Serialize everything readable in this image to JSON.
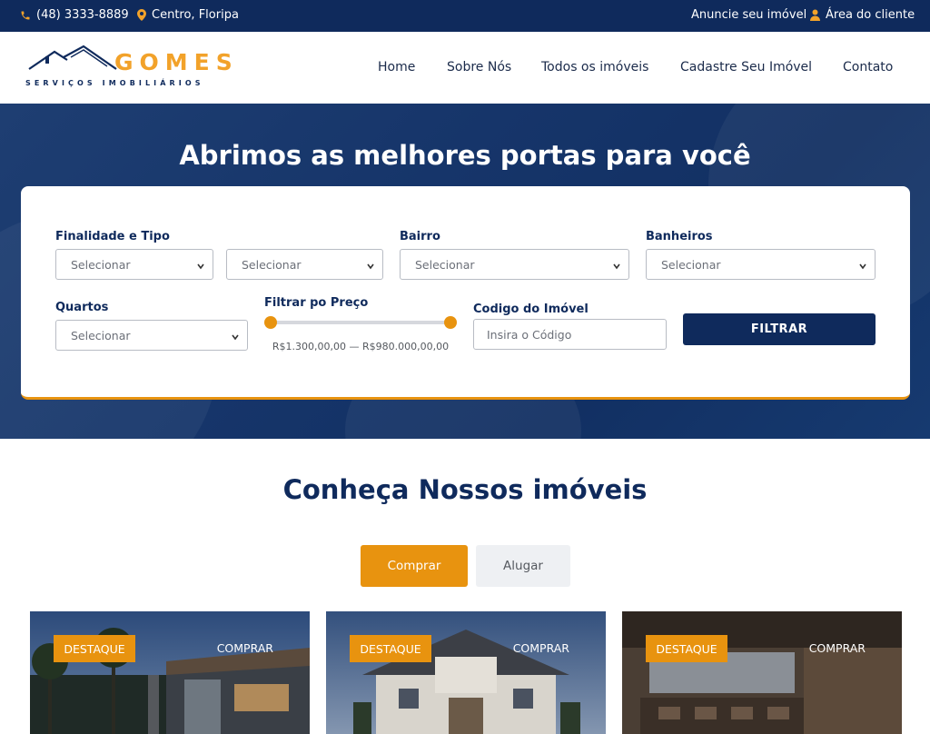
{
  "topbar": {
    "phone": "(48) 3333-8889",
    "location": "Centro, Floripa",
    "advertise": "Anuncie seu imóvel",
    "client_area": "Área do cliente"
  },
  "header": {
    "logo_word": "GOMES",
    "logo_tagline": "SERVIÇOS IMOBILIÁRIOS",
    "nav": [
      "Home",
      "Sobre Nós",
      "Todos os imóveis",
      "Cadastre Seu Imóvel",
      "Contato"
    ]
  },
  "hero": {
    "title": "Abrimos as melhores portas para você"
  },
  "search": {
    "purpose_label": "Finalidade e Tipo",
    "neighborhood_label": "Bairro",
    "bathrooms_label": "Banheiros",
    "rooms_label": "Quartos",
    "price_label": "Filtrar po Preço",
    "code_label": "Codigo do Imóvel",
    "select_placeholder": "Selecionar",
    "code_placeholder": "Insira o Código",
    "price_range": "R$1.300,00,00 — R$980.000,00,00",
    "filter_button": "FILTRAR"
  },
  "listings": {
    "title": "Conheça Nossos imóveis",
    "tabs": [
      "Comprar",
      "Alugar"
    ],
    "active_tab": "Comprar",
    "cards": [
      {
        "badge": "DESTAQUE",
        "tag": "COMPRAR"
      },
      {
        "badge": "DESTAQUE",
        "tag": "COMPRAR"
      },
      {
        "badge": "DESTAQUE",
        "tag": "COMPRAR"
      }
    ]
  },
  "colors": {
    "navy": "#0f2a5c",
    "orange": "#e8930f",
    "logo_gold": "#f2a22a"
  },
  "icons": [
    "phone-icon",
    "map-pin-icon",
    "user-icon",
    "chevron-down-icon"
  ]
}
